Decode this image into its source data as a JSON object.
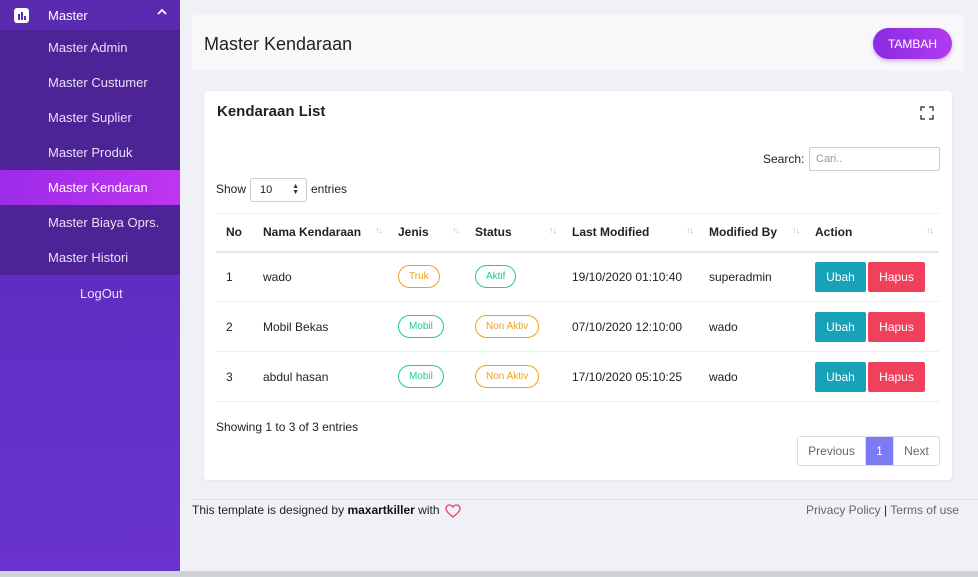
{
  "sidebar": {
    "section": "Master",
    "items": [
      {
        "label": "Master Admin"
      },
      {
        "label": "Master Custumer"
      },
      {
        "label": "Master Suplier"
      },
      {
        "label": "Master Produk"
      },
      {
        "label": "Master Kendaran",
        "active": true
      },
      {
        "label": "Master Biaya Oprs."
      },
      {
        "label": "Master Histori"
      }
    ],
    "logout": "LogOut"
  },
  "header": {
    "title": "Master Kendaraan",
    "add_button": "TAMBAH"
  },
  "card": {
    "title": "Kendaraan List",
    "search_label": "Search:",
    "search_placeholder": "Cari..",
    "show_label": "Show",
    "page_length": "10",
    "entries_label": "entries",
    "columns": [
      "No",
      "Nama Kendaraan",
      "Jenis",
      "Status",
      "Last Modified",
      "Modified By",
      "Action"
    ],
    "rows": [
      {
        "no": "1",
        "nama": "wado",
        "jenis": "Truk",
        "status": "Aktif",
        "last_modified": "19/10/2020 01:10:40",
        "modified_by": "superadmin",
        "edit": "Ubah",
        "delete": "Hapus"
      },
      {
        "no": "2",
        "nama": "Mobil Bekas",
        "jenis": "Mobil",
        "status": "Non Aktiv",
        "last_modified": "07/10/2020 12:10:00",
        "modified_by": "wado",
        "edit": "Ubah",
        "delete": "Hapus"
      },
      {
        "no": "3",
        "nama": "abdul hasan",
        "jenis": "Mobil",
        "status": "Non Aktiv",
        "last_modified": "17/10/2020 05:10:25",
        "modified_by": "wado",
        "edit": "Ubah",
        "delete": "Hapus"
      }
    ],
    "info": "Showing 1 to 3 of 3 entries",
    "pagination": {
      "previous": "Previous",
      "current": "1",
      "next": "Next"
    }
  },
  "footer": {
    "text_before": "This template is designed by",
    "author": "maxartkiller",
    "text_after": "with",
    "privacy": "Privacy Policy",
    "separator": "|",
    "terms": "Terms of use"
  },
  "colors": {
    "accent": "#8a2be2",
    "ubah": "#17a2b8",
    "hapus": "#f0405c",
    "truk_badge": "#f0a020",
    "mobil_badge": "#20c997"
  },
  "icons": {
    "section": "chart-icon",
    "collapse": "chevron-up-icon",
    "expand": "fullscreen-icon",
    "love": "heart-icon"
  }
}
